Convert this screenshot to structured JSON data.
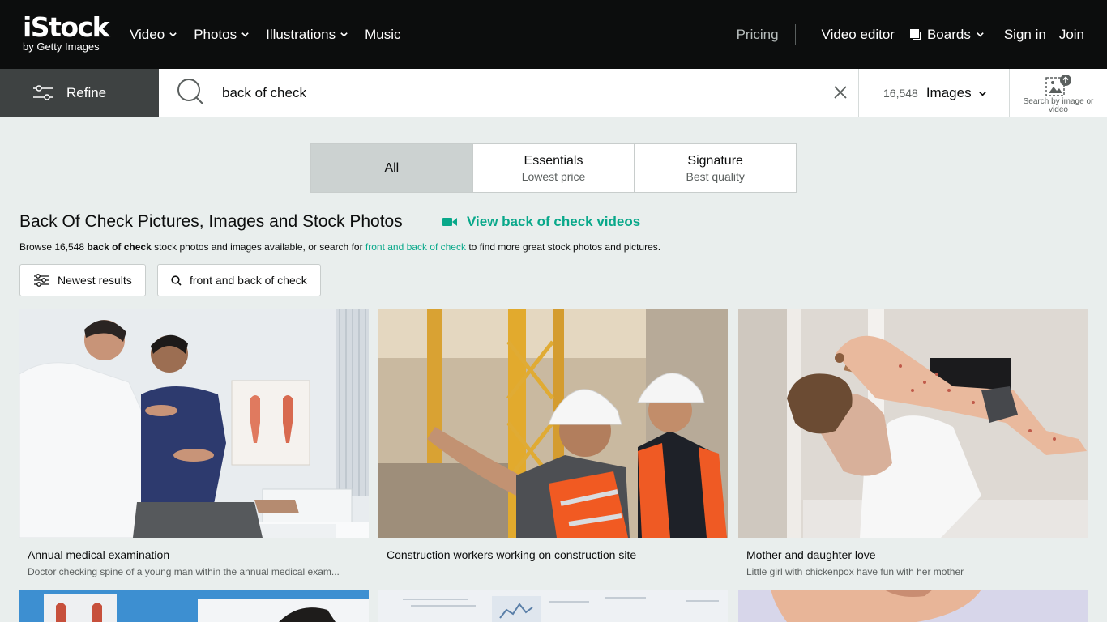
{
  "nav": {
    "logo_main": "iStock",
    "logo_sub": "by Getty Images",
    "items": [
      {
        "label": "Video",
        "has_dropdown": true
      },
      {
        "label": "Photos",
        "has_dropdown": true
      },
      {
        "label": "Illustrations",
        "has_dropdown": true
      },
      {
        "label": "Music",
        "has_dropdown": false
      }
    ],
    "pricing": "Pricing",
    "video_editor": "Video editor",
    "boards": "Boards",
    "sign_in": "Sign in",
    "join": "Join"
  },
  "search": {
    "refine_label": "Refine",
    "query": "back of check",
    "result_count": "16,548",
    "media_type": "Images",
    "search_by_image_label": "Search by image or video"
  },
  "tabs": [
    {
      "title": "All",
      "subtitle": "",
      "active": true
    },
    {
      "title": "Essentials",
      "subtitle": "Lowest price",
      "active": false
    },
    {
      "title": "Signature",
      "subtitle": "Best quality",
      "active": false
    }
  ],
  "page": {
    "heading": "Back Of Check Pictures, Images and Stock Photos",
    "video_link": "View back of check videos",
    "browse_prefix": "Browse 16,548 ",
    "browse_term": "back of check",
    "browse_mid": " stock photos and images available, or search for ",
    "browse_link": "front and back of check",
    "browse_suffix": " to find more great stock photos and pictures."
  },
  "chips": {
    "newest": "Newest results",
    "related": "front and back of check"
  },
  "results": [
    {
      "title": "Annual medical examination",
      "description": "Doctor checking spine of a young man within the annual medical exam..."
    },
    {
      "title": "Construction workers working on construction site",
      "description": ""
    },
    {
      "title": "Mother and daughter love",
      "description": "Little girl with chickenpox have fun with her mother"
    }
  ],
  "colors": {
    "nav_bg": "#0c0d0d",
    "accent": "#08a88a",
    "page_bg": "#e9eeed",
    "refine_bg": "#3e4242"
  }
}
